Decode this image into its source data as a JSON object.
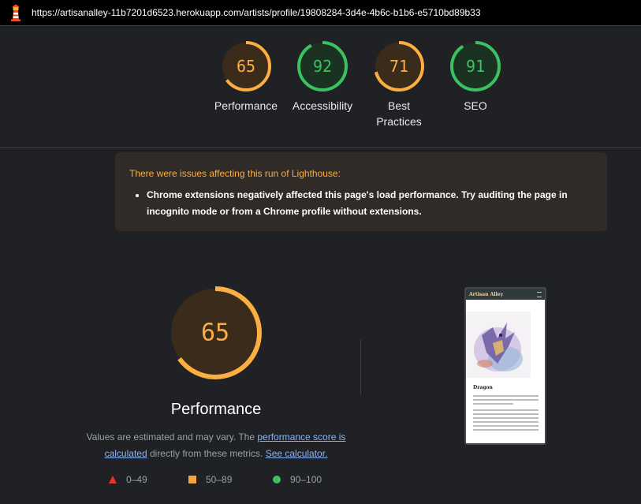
{
  "header": {
    "url": "https://artisanalley-11b7201d6523.herokuapp.com/artists/profile/19808284-3d4e-4b6c-b1b6-e5710bd89b33",
    "logo_icon": "lighthouse-icon"
  },
  "scores": [
    {
      "value": 65,
      "label": "Performance",
      "color": "#fbae42",
      "bg": "#3a2b1b"
    },
    {
      "value": 92,
      "label": "Accessibility",
      "color": "#3bc260",
      "bg": "#1b3122"
    },
    {
      "value": 71,
      "label": "Best Practices",
      "color": "#fbae42",
      "bg": "#3a2b1b"
    },
    {
      "value": 91,
      "label": "SEO",
      "color": "#3bc260",
      "bg": "#1b3122"
    }
  ],
  "warning": {
    "title": "There were issues affecting this run of Lighthouse:",
    "item": "Chrome extensions negatively affected this page's load performance. Try auditing the page in incognito mode or from a Chrome profile without extensions."
  },
  "performance": {
    "score": 65,
    "title": "Performance",
    "desc_prefix": "Values are estimated and may vary. The ",
    "link1": "performance score is calculated",
    "desc_middle": " directly from these metrics. ",
    "link2": "See calculator."
  },
  "legend": {
    "fail": "0–49",
    "average": "50–89",
    "pass": "90–100"
  },
  "screenshot": {
    "brand": "Artisan Alley",
    "artist_name": "Dragon"
  }
}
